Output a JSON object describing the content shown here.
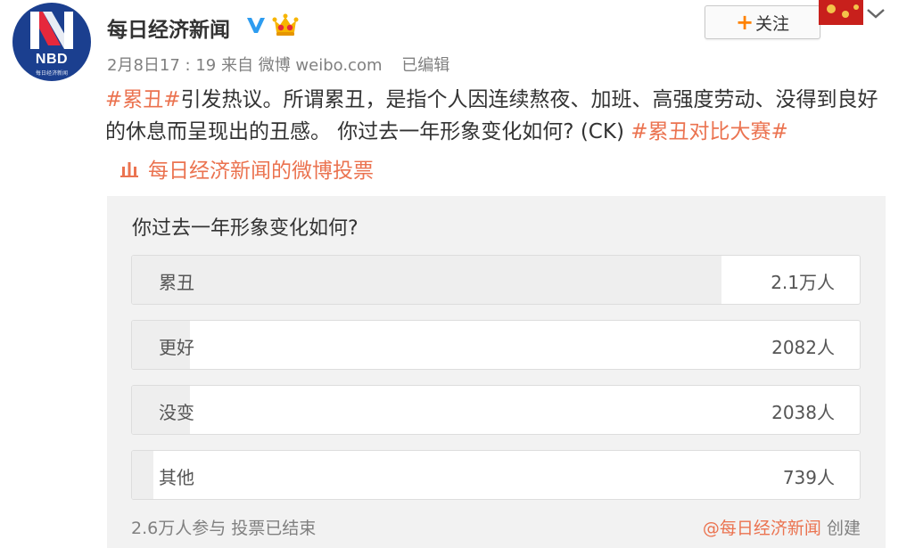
{
  "account": {
    "avatar_text": "NBD",
    "avatar_subtext": "每日经济新闻",
    "username": "每日经济新闻",
    "verified_icon": "verified-v-icon",
    "vip_icon": "vip-crown-icon",
    "follow_label": "关注",
    "chevron_icon": "chevron-down-icon"
  },
  "meta": {
    "time": "2月8日17 : 19",
    "source": "来自 微博 weibo.com",
    "edited": "已编辑"
  },
  "post": {
    "tag1": "#累丑#",
    "text1": "引发热议。所谓累丑，是指个人因连续熬夜、加班、高强度劳动、没得到良好的休息而呈现出的丑感。 你过去一年形象变化如何? (CK) ",
    "tag2": "#累丑对比大赛#",
    "vote_link": "每日经济新闻的微博投票"
  },
  "poll": {
    "question": "你过去一年形象变化如何?",
    "options": [
      {
        "label": "累丑",
        "count": "2.1万人",
        "share": 0.81
      },
      {
        "label": "更好",
        "count": "2082人",
        "share": 0.08
      },
      {
        "label": "没变",
        "count": "2038人",
        "share": 0.08
      },
      {
        "label": "其他",
        "count": "739人",
        "share": 0.03
      }
    ],
    "summary": "2.6万人参与 投票已结束",
    "creator": "@每日经济新闻",
    "created_label": "创建"
  },
  "colors": {
    "accent": "#eb7350",
    "follow_plus": "#ff8200",
    "verified": "#2d9cf0",
    "brand_blue": "#1b3f8f",
    "brand_red": "#e6283c"
  }
}
